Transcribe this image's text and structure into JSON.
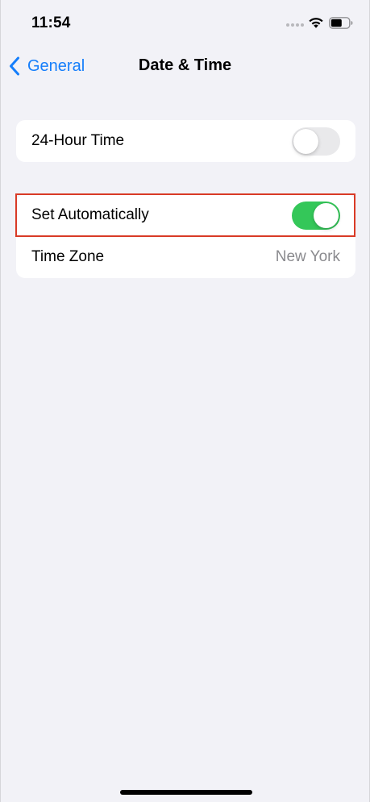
{
  "status_bar": {
    "time": "11:54",
    "icons": [
      "signal-dots-icon",
      "wifi-icon",
      "battery-icon"
    ]
  },
  "nav": {
    "back_label": "General",
    "title": "Date & Time"
  },
  "groups": [
    {
      "rows": [
        {
          "label": "24-Hour Time",
          "control": "toggle",
          "on": false
        }
      ]
    },
    {
      "rows": [
        {
          "label": "Set Automatically",
          "control": "toggle",
          "on": true,
          "highlighted": true
        },
        {
          "label": "Time Zone",
          "value": "New York"
        }
      ]
    }
  ],
  "colors": {
    "background": "#f2f2f7",
    "accent": "#157efb",
    "toggle_on": "#34c759",
    "toggle_off": "#e9e9eb",
    "highlight": "#d93a26",
    "secondary_text": "#8a8a8e"
  }
}
